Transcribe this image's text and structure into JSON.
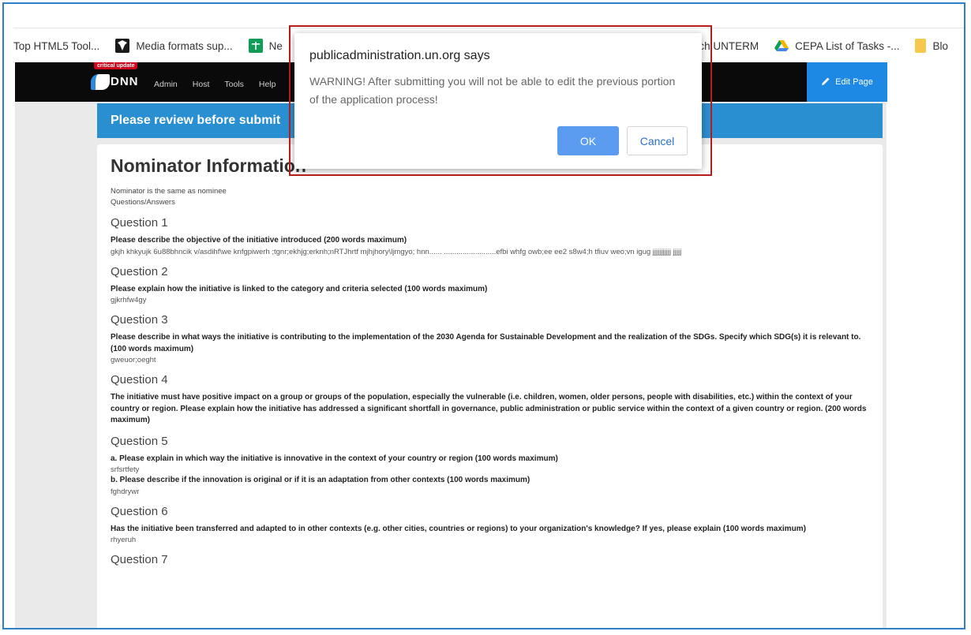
{
  "bookmarks": [
    {
      "label": "Top HTML5 Tool...",
      "icon": "page-icon",
      "color": "#ffffff"
    },
    {
      "label": "Media formats sup...",
      "icon": "mdn-icon",
      "color": "#1a1a1a"
    },
    {
      "label": "Ne",
      "icon": "sheets-icon",
      "color": "#0f9d58"
    },
    {
      "label": "Search UNTERM",
      "icon": "none",
      "color": ""
    },
    {
      "label": "CEPA List of Tasks -...",
      "icon": "drive-icon",
      "color": "#f4b400"
    },
    {
      "label": "Blo",
      "icon": "folder-icon",
      "color": "#f6c94c"
    }
  ],
  "dnn": {
    "badge": "critical update",
    "logo_text": "DNN",
    "nav": [
      "Admin",
      "Host",
      "Tools",
      "Help"
    ],
    "edit_page": "Edit Page"
  },
  "page": {
    "review_banner": "Please review before submit",
    "heading": "Nominator Information",
    "nominator_note": "Nominator is the same as nominee",
    "qa_label": "Questions/Answers",
    "questions": [
      {
        "title": "Question 1",
        "prompt": "Please describe the objective of the initiative introduced (200 words maximum)",
        "answer": "gkjh khkyujk 6u88bhncik v/asdihf\\we knfgpiwerh ;tgnr;ekhjg;erknh;nRTJhrtf mjhjhory\\ljmgyo; hnn...... .........................efbi whfg owb;ee ee2 s8w4;h tfiuv weo;vn igug jjjjjjjjjjj jjjjj"
      },
      {
        "title": "Question 2",
        "prompt": "Please explain how the initiative is linked to the category and criteria selected (100 words maximum)",
        "answer": "gjkrhfw4gy"
      },
      {
        "title": "Question 3",
        "prompt": "Please describe in what ways the initiative is contributing to the implementation of the 2030 Agenda for Sustainable Development and the realization of the SDGs. Specify which SDG(s) it is relevant to. (100 words maximum)",
        "answer": "gweuor;oeght"
      },
      {
        "title": "Question 4",
        "prompt": "The initiative must have positive impact on a group or groups of the population, especially the vulnerable (i.e. children, women, older persons, people with disabilities, etc.) within the context of your country or region. Please explain how the initiative has addressed a significant shortfall in governance, public administration or public service within the context of a given country or region. (200 words maximum)",
        "answer": ""
      },
      {
        "title": "Question 5",
        "prompt": "a. Please explain in which way the initiative is innovative in the context of your country or region (100 words maximum)",
        "answer": "srfsrtfety",
        "prompt2": "b. Please describe if the innovation is original or if it is an adaptation from other contexts (100 words maximum)",
        "answer2": "fghdrywr"
      },
      {
        "title": "Question 6",
        "prompt": "Has the initiative been transferred and adapted to in other contexts (e.g. other cities, countries or regions) to your organization's knowledge? If yes, please explain (100 words maximum)",
        "answer": "rhyeruh"
      },
      {
        "title": "Question 7",
        "prompt": "",
        "answer": ""
      }
    ]
  },
  "dialog": {
    "origin": "publicadministration.un.org says",
    "message": "WARNING! After submitting you will not be able to edit the previous portion of the application process!",
    "ok_label": "OK",
    "cancel_label": "Cancel"
  },
  "colors": {
    "review_banner": "#2a8fd0",
    "edit_page": "#1e88e5",
    "ok_button": "#5b9cf0",
    "highlight": "#b71c1c"
  }
}
